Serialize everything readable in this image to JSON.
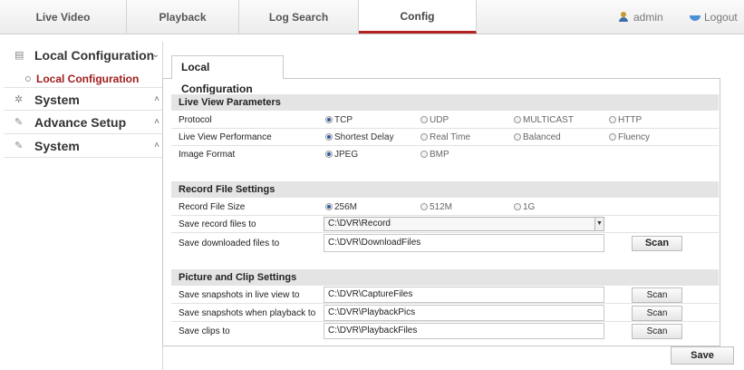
{
  "nav": {
    "tabs": [
      {
        "label": "Live Video"
      },
      {
        "label": "Playback"
      },
      {
        "label": "Log Search"
      },
      {
        "label": "Config"
      }
    ],
    "user": "admin",
    "logout": "Logout",
    "active_color": "#b22222"
  },
  "sidebar": {
    "items": [
      {
        "label": "Local Configuration",
        "icon": "monitor-icon",
        "arrow": "⌄"
      },
      {
        "label": "System",
        "icon": "gear-icon",
        "arrow": "˄"
      },
      {
        "label": "Advance Setup",
        "icon": "wrench-icon",
        "arrow": "˄"
      },
      {
        "label": "System",
        "icon": "wrench-icon",
        "arrow": "˄"
      }
    ],
    "sub_item": "Local Configuration",
    "sub_color": "#a11d1d"
  },
  "content": {
    "tab": "Local Configuration",
    "live_view": {
      "header": "Live View Parameters",
      "protocol": {
        "label": "Protocol",
        "options": [
          "TCP",
          "UDP",
          "MULTICAST",
          "HTTP"
        ],
        "selected": "TCP"
      },
      "performance": {
        "label": "Live View Performance",
        "options": [
          "Shortest Delay",
          "Real Time",
          "Balanced",
          "Fluency"
        ],
        "selected": "Shortest Delay"
      },
      "image_format": {
        "label": "Image Format",
        "options": [
          "JPEG",
          "BMP"
        ],
        "selected": "JPEG"
      }
    },
    "record": {
      "header": "Record File Settings",
      "size": {
        "label": "Record File Size",
        "options": [
          "256M",
          "512M",
          "1G"
        ],
        "selected": "256M"
      },
      "save_to": {
        "label": "Save record files to",
        "value": "C:\\DVR\\Record"
      },
      "downloaded": {
        "label": "Save downloaded files to",
        "value": "C:\\DVR\\DownloadFiles",
        "button": "Scan"
      }
    },
    "picture": {
      "header": "Picture and Clip Settings",
      "snap_live": {
        "label": "Save snapshots in live view to",
        "value": "C:\\DVR\\CaptureFiles",
        "button": "Scan"
      },
      "snap_playback": {
        "label": "Save snapshots when playback to",
        "value": "C:\\DVR\\PlaybackPics",
        "button": "Scan"
      },
      "clips": {
        "label": "Save clips to",
        "value": "C:\\DVR\\PlaybackFiles",
        "button": "Scan"
      }
    },
    "save": "Save"
  }
}
